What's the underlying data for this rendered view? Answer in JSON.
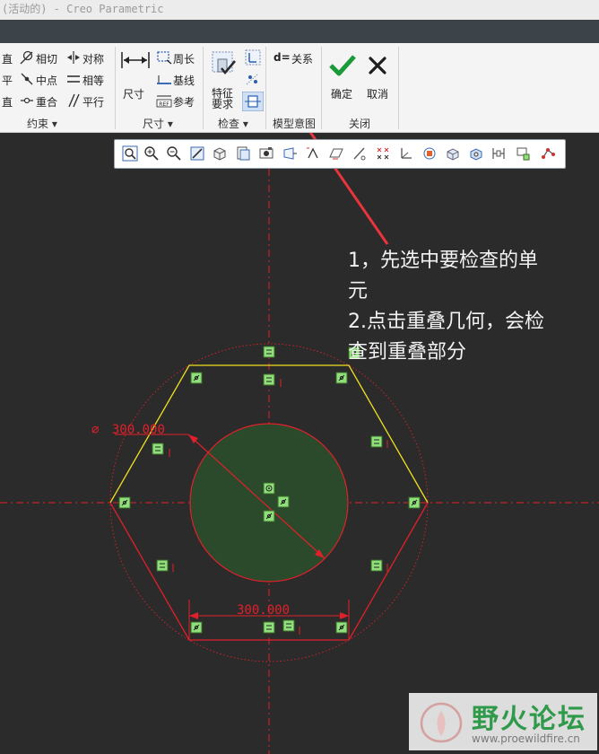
{
  "window": {
    "title": "(活动的) - Creo Parametric"
  },
  "ribbon": {
    "constraint": {
      "items": [
        "直",
        "相切",
        "对称",
        "平",
        "中点",
        "相等",
        "直",
        "重合",
        "平行"
      ],
      "label": "约束 ▾"
    },
    "dimension": {
      "big_label": "尺寸",
      "items": [
        "周长",
        "基线",
        "参考"
      ],
      "label": "尺寸 ▾"
    },
    "inspect": {
      "feature_label_1": "特征",
      "feature_label_2": "要求",
      "label": "检查 ▾"
    },
    "relation": {
      "item": "关系",
      "prefix": "d="
    },
    "model_intent_label": "模型意图",
    "close": {
      "ok": "确定",
      "cancel": "取消",
      "label": "关闭"
    }
  },
  "drawing": {
    "diameter_dim": "300.000",
    "diameter_symbol": "⌀",
    "length_dim": "300.000"
  },
  "annotation": {
    "line1": "1，先选中要检查的单",
    "line2": "元",
    "line3": "2.点击重叠几何，会检",
    "line4": "查到重叠部分"
  },
  "watermark": {
    "name": "野火论坛",
    "url": "www.proewildfire.cn"
  },
  "colors": {
    "canvas": "#2b2b2b",
    "sketch_red": "#e0202a",
    "sketch_yellow": "#f0e020",
    "fill_green": "#2b4a2b",
    "constraint_green": "#8fe07a",
    "arrow_red": "#e8343a"
  }
}
